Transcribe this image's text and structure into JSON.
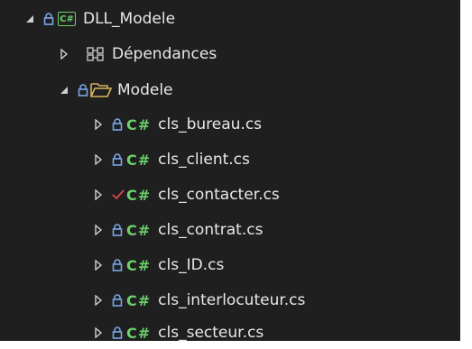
{
  "colors": {
    "background": "#1f1f1f",
    "text": "#e8e8e8",
    "lock": "#7aa6e6",
    "csharp": "#6bd06b",
    "folder": "#d9b45a",
    "check": "#e0474c"
  },
  "tree": {
    "project": {
      "label": "DLL_Modele",
      "icon": "csharp-project-icon"
    },
    "dependencies": {
      "label": "Dépendances",
      "icon": "dependencies-icon"
    },
    "folder": {
      "label": "Modele",
      "icon": "folder-open-icon"
    },
    "csharp_glyph": "C#",
    "project_glyph": "C#",
    "files": [
      {
        "label": "cls_bureau.cs",
        "status": "locked"
      },
      {
        "label": "cls_client.cs",
        "status": "locked"
      },
      {
        "label": "cls_contacter.cs",
        "status": "modified"
      },
      {
        "label": "cls_contrat.cs",
        "status": "locked"
      },
      {
        "label": "cls_ID.cs",
        "status": "locked"
      },
      {
        "label": "cls_interlocuteur.cs",
        "status": "locked"
      },
      {
        "label": "cls_secteur.cs",
        "status": "locked"
      }
    ]
  }
}
